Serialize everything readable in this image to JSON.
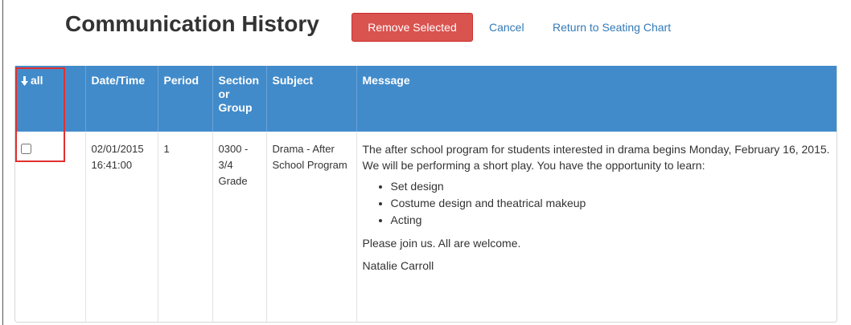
{
  "header": {
    "title": "Communication History",
    "remove_label": "Remove Selected",
    "cancel_label": "Cancel",
    "return_label": "Return to Seating Chart"
  },
  "table": {
    "columns": {
      "select_all": "all",
      "datetime": "Date/Time",
      "period": "Period",
      "section": "Section or Group",
      "subject": "Subject",
      "message": "Message"
    },
    "rows": [
      {
        "checked": false,
        "datetime": "02/01/2015 16:41:00",
        "period": "1",
        "section": "0300 - 3/4 Grade",
        "subject": "Drama - After School Program",
        "message": {
          "intro": "The after school program for students interested in drama begins Monday, February 16, 2015.  We will be performing a short play. You have the opportunity to learn:",
          "bullets": [
            "Set design",
            "Costume design and theatrical makeup",
            "Acting"
          ],
          "closing": "Please join us. All are welcome.",
          "signature": "Natalie Carroll"
        }
      }
    ]
  },
  "icons": {
    "sort": "arrow-down-icon"
  },
  "colors": {
    "header_bg": "#428bca",
    "danger": "#d9534f",
    "link": "#337ab7",
    "highlight": "#e03030"
  }
}
